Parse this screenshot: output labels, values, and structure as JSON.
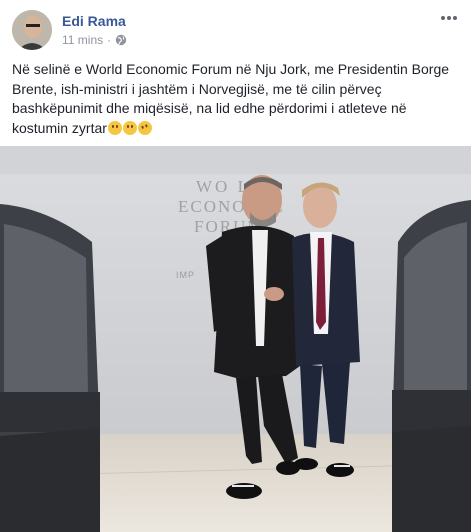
{
  "post": {
    "author": "Edi Rama",
    "timestamp": "11 mins",
    "separator": "·",
    "privacy_icon": "globe-icon",
    "more_icon": "more-dots-icon",
    "text": "Në selinë e World Economic Forum në Nju Jork, me Presidentin Borge Brente, ish-ministri i jashtëm i Norvegjisë, me të cilin përveç bashkëpunimit dhe miqësisë, na lid edhe përdorimi i atleteve në kostumin zyrtar",
    "emojis": [
      "winking-face-emoji",
      "grinning-face-emoji",
      "rolling-laughing-emoji"
    ]
  },
  "photo": {
    "wall_sign_line1": "WO  LD",
    "wall_sign_line2": "ECONOMIC",
    "wall_sign_line3": "FORUM",
    "wall_sign_line4": "IMP"
  },
  "colors": {
    "author_link": "#385898",
    "meta_gray": "#90949c",
    "body_text": "#1d2129"
  }
}
